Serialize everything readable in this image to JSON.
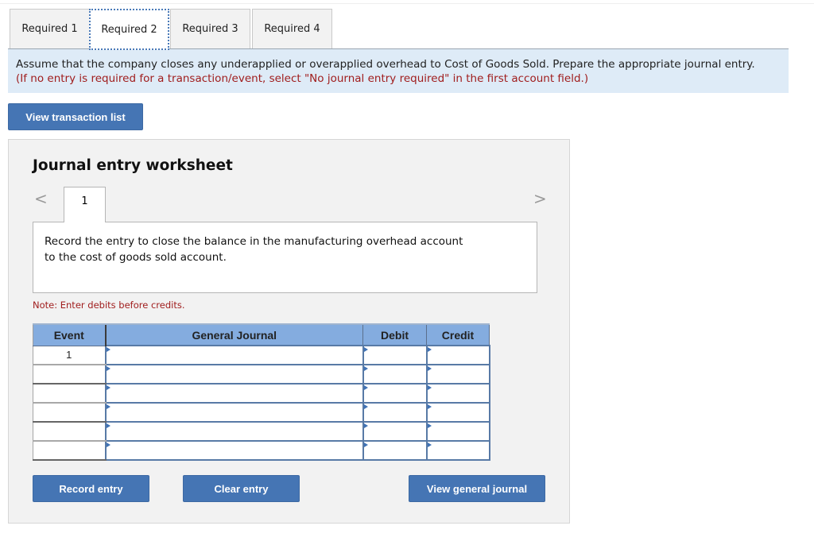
{
  "tabs": [
    {
      "label": "Required 1",
      "active": false
    },
    {
      "label": "Required 2",
      "active": true
    },
    {
      "label": "Required 3",
      "active": false
    },
    {
      "label": "Required 4",
      "active": false
    }
  ],
  "instruction": {
    "main": "Assume that the company closes any underapplied or overapplied overhead to Cost of Goods Sold. Prepare the appropriate journal entry.",
    "hint": "(If no entry is required for a transaction/event, select \"No journal entry required\" in the first account field.)"
  },
  "view_transaction_list_label": "View transaction list",
  "worksheet": {
    "title": "Journal entry worksheet",
    "prev_icon": "chevron-left-icon",
    "next_icon": "chevron-right-icon",
    "prev_glyph": "<",
    "next_glyph": ">",
    "current_entry": "1",
    "description_line1": "Record the entry to close the balance in the manufacturing overhead account",
    "description_line2": "to the cost of goods sold account.",
    "note": "Note: Enter debits before credits.",
    "table": {
      "headers": {
        "event": "Event",
        "general_journal": "General Journal",
        "debit": "Debit",
        "credit": "Credit"
      },
      "rows": [
        {
          "event": "1",
          "account": "",
          "debit": "",
          "credit": ""
        },
        {
          "event": "",
          "account": "",
          "debit": "",
          "credit": ""
        },
        {
          "event": "",
          "account": "",
          "debit": "",
          "credit": ""
        },
        {
          "event": "",
          "account": "",
          "debit": "",
          "credit": ""
        },
        {
          "event": "",
          "account": "",
          "debit": "",
          "credit": ""
        },
        {
          "event": "",
          "account": "",
          "debit": "",
          "credit": ""
        }
      ]
    },
    "buttons": {
      "record": "Record entry",
      "clear": "Clear entry",
      "view_general_journal": "View general journal"
    }
  },
  "colors": {
    "button_blue": "#4575b4",
    "header_blue": "#84acdf",
    "instruction_bg": "#deebf7",
    "hint_red": "#a01d1d"
  }
}
